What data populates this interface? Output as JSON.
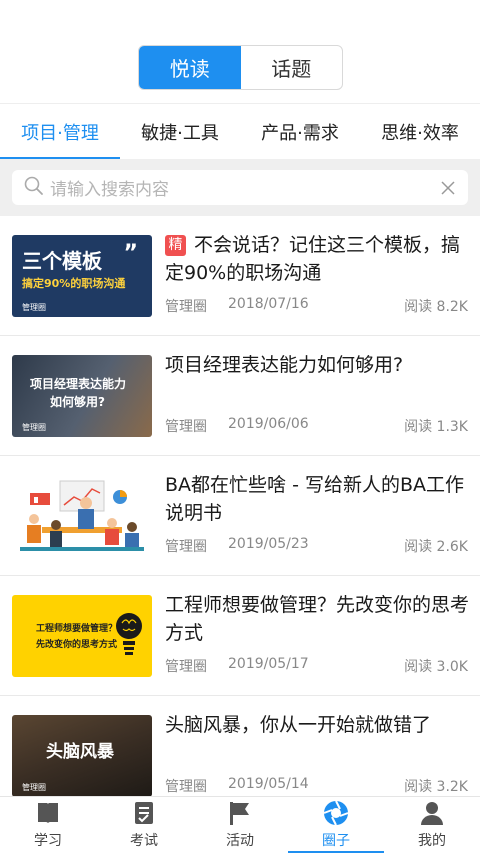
{
  "segment": {
    "items": [
      "悦读",
      "话题"
    ],
    "active": 0
  },
  "categories": [
    {
      "label": "项目·管理",
      "active": true
    },
    {
      "label": "敏捷·工具",
      "active": false
    },
    {
      "label": "产品·需求",
      "active": false
    },
    {
      "label": "思维·效率",
      "active": false
    }
  ],
  "search": {
    "placeholder": "请输入搜索内容",
    "icon": "search-icon",
    "clear_icon": "close-icon"
  },
  "articles": [
    {
      "badge": "精",
      "title": "不会说话？记住这三个模板，搞定90%的职场沟通",
      "source": "管理圈",
      "date": "2018/07/16",
      "reads": "阅读 8.2K",
      "thumb": {
        "headline": "三个模板",
        "sub": "搞定90%的职场沟通",
        "brand": "管理圈"
      }
    },
    {
      "badge": "",
      "title": "项目经理表达能力如何够用?",
      "source": "管理圈",
      "date": "2019/06/06",
      "reads": "阅读 1.3K",
      "thumb": {
        "headline": "项目经理表达能力",
        "sub": "如何够用?",
        "brand": "管理圈"
      }
    },
    {
      "badge": "",
      "title": "BA都在忙些啥 - 写给新人的BA工作说明书",
      "source": "管理圈",
      "date": "2019/05/23",
      "reads": "阅读 2.6K",
      "thumb": {
        "headline": "",
        "sub": "",
        "brand": ""
      }
    },
    {
      "badge": "",
      "title": "工程师想要做管理？先改变你的思考方式",
      "source": "管理圈",
      "date": "2019/05/17",
      "reads": "阅读 3.0K",
      "thumb": {
        "headline": "工程师想要做管理？",
        "sub": "先改变你的思考方式",
        "brand": ""
      }
    },
    {
      "badge": "",
      "title": "头脑风暴，你从一开始就做错了",
      "source": "管理圈",
      "date": "2019/05/14",
      "reads": "阅读 3.2K",
      "thumb": {
        "headline": "头脑风暴",
        "sub": "",
        "brand": "管理圈"
      }
    }
  ],
  "tabbar": [
    {
      "label": "学习",
      "icon": "book-icon",
      "active": false
    },
    {
      "label": "考试",
      "icon": "exam-icon",
      "active": false
    },
    {
      "label": "活动",
      "icon": "flag-icon",
      "active": false
    },
    {
      "label": "圈子",
      "icon": "aperture-icon",
      "active": true
    },
    {
      "label": "我的",
      "icon": "person-icon",
      "active": false
    }
  ],
  "colors": {
    "accent": "#1e8ff0",
    "badge": "#f05050"
  }
}
